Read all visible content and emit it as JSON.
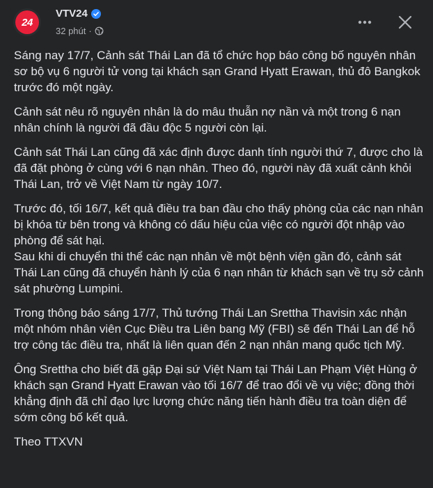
{
  "post": {
    "page_name": "VTV24",
    "avatar_text": "24",
    "timestamp": "32 phút",
    "meta_separator": "·",
    "icons": {
      "verified": "verified-badge-icon",
      "audience": "globe-icon",
      "more": "more-horizontal-icon",
      "close": "close-icon"
    },
    "colors": {
      "brand": "#e8203a",
      "verified": "#2d88ff"
    },
    "paragraphs": [
      "Sáng nay 17/7, Cảnh sát Thái Lan đã tổ chức họp báo công bố nguyên nhân sơ bộ vụ 6 người tử vong tại khách sạn Grand Hyatt Erawan, thủ đô Bangkok trước đó một ngày.",
      "Cảnh sát nêu rõ nguyên nhân là do mâu thuẫn nợ nần và một trong 6 nạn nhân chính là người đã đầu độc 5 người còn lại.",
      "Cảnh sát Thái Lan cũng đã xác định được danh tính người thứ 7, được cho là đã đặt phòng ở cùng với 6 nạn nhân. Theo đó, người này đã xuất cảnh khỏi Thái Lan, trở về Việt Nam từ ngày 10/7.",
      "Trước đó, tối 16/7, kết quả điều tra ban đầu cho thấy phòng của các nạn nhân bị khóa từ bên trong và không có dấu hiệu của việc có người đột nhập vào phòng để sát hại.\nSau khi di chuyển thi thể các nạn nhân về một bệnh viện gần đó, cảnh sát Thái Lan cũng đã chuyển hành lý của 6 nạn nhân từ khách sạn về trụ sở cảnh sát phường Lumpini.",
      "Trong thông báo sáng 17/7, Thủ tướng Thái Lan Srettha Thavisin xác nhận một nhóm nhân viên Cục Điều tra Liên bang Mỹ (FBI) sẽ đến Thái Lan để hỗ trợ công tác điều tra, nhất là liên quan đến 2 nạn nhân mang quốc tịch Mỹ.",
      "Ông Srettha cho biết đã gặp Đại sứ Việt Nam tại Thái Lan Phạm Việt Hùng ở khách sạn Grand Hyatt Erawan vào tối 16/7 để trao đổi về vụ việc; đồng thời khẳng định đã chỉ đạo lực lượng chức năng tiến hành điều tra toàn diện để sớm công bố kết quả.",
      "Theo TTXVN"
    ]
  }
}
